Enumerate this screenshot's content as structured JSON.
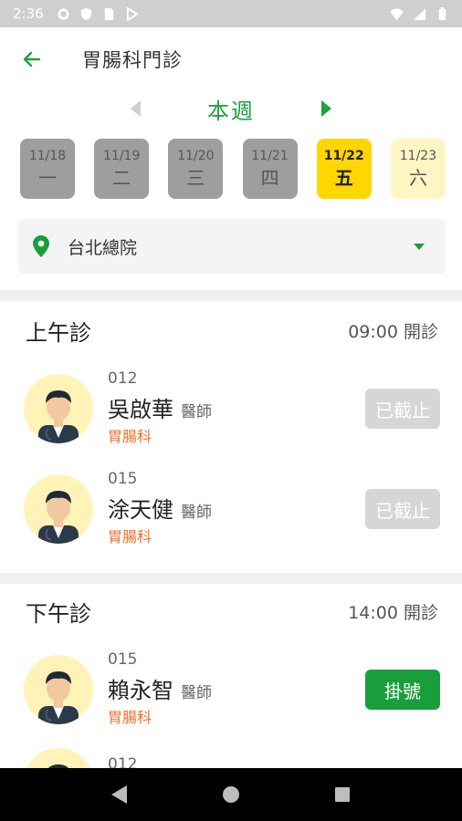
{
  "status_bar": {
    "time": "2:36"
  },
  "header": {
    "title": "胃腸科門診"
  },
  "week": {
    "label": "本週"
  },
  "days": [
    {
      "date": "11/18",
      "weekday": "一",
      "state": "disabled"
    },
    {
      "date": "11/19",
      "weekday": "二",
      "state": "disabled"
    },
    {
      "date": "11/20",
      "weekday": "三",
      "state": "disabled"
    },
    {
      "date": "11/21",
      "weekday": "四",
      "state": "disabled"
    },
    {
      "date": "11/22",
      "weekday": "五",
      "state": "selected"
    },
    {
      "date": "11/23",
      "weekday": "六",
      "state": "available"
    }
  ],
  "location": {
    "name": "台北總院"
  },
  "sessions": [
    {
      "name": "上午診",
      "time": "09:00 開診",
      "doctors": [
        {
          "id": "012",
          "name": "吳啟華",
          "title": "醫師",
          "dept": "胃腸科",
          "button": "已截止"
        },
        {
          "id": "015",
          "name": "涂天健",
          "title": "醫師",
          "dept": "胃腸科",
          "button": "已截止"
        }
      ]
    },
    {
      "name": "下午診",
      "time": "14:00 開診",
      "doctors": [
        {
          "id": "015",
          "name": "賴永智",
          "title": "醫師",
          "dept": "胃腸科",
          "button": "掛號"
        },
        {
          "id": "012",
          "name": "",
          "title": "",
          "dept": "",
          "button": ""
        }
      ]
    }
  ],
  "colors": {
    "accent_green": "#20a040",
    "button_green": "#1a9e3c",
    "selected_day": "#ffd600",
    "dept_orange": "#f07030"
  }
}
